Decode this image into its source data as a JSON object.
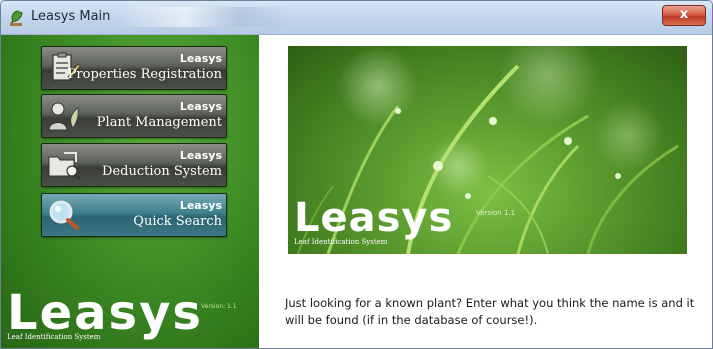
{
  "window": {
    "title": "Leasys Main",
    "close_label": "x"
  },
  "sidebar": {
    "buttons": [
      {
        "brand": "Leasys",
        "label": "Properties Registration",
        "icon": "clipboard-icon",
        "active": false
      },
      {
        "brand": "Leasys",
        "label": "Plant Management",
        "icon": "person-plant-icon",
        "active": false
      },
      {
        "brand": "Leasys",
        "label": "Deduction System",
        "icon": "folder-search-icon",
        "active": false
      },
      {
        "brand": "Leasys",
        "label": "Quick Search",
        "icon": "magnifier-icon",
        "active": true
      }
    ],
    "logo": {
      "word": "Leasys",
      "subtitle": "Leaf Identification System",
      "version": "Version: 1.1"
    }
  },
  "banner": {
    "word": "Leasys",
    "subtitle": "Leaf Identification System",
    "version": "Version 1.1"
  },
  "hint": {
    "text": "Just looking for a known plant? Enter what you think the name is and it will be found (if in the database of course!)."
  },
  "colors": {
    "sidebar_green": "#3f8e26",
    "button_dark": "#4b4f49",
    "button_active": "#3f7f8d",
    "close_red": "#c0392b"
  }
}
